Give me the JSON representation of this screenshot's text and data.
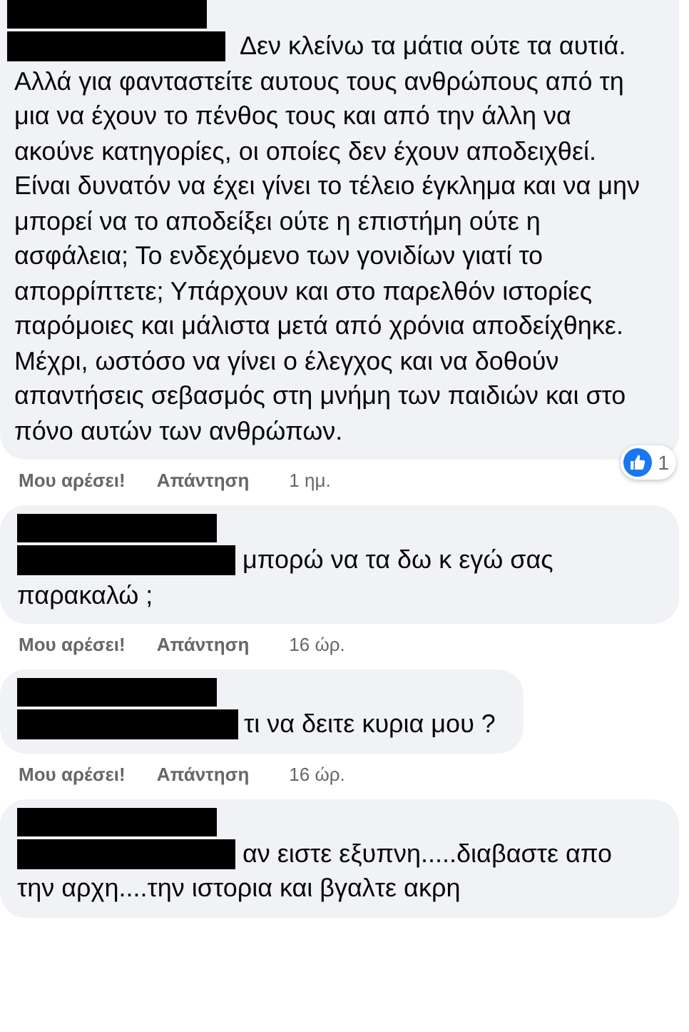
{
  "comments": [
    {
      "text": "Δεν κλείνω τα μάτια ούτε τα αυτιά. Αλλά για φανταστείτε αυτους τους ανθρώπους από τη μια να έχουν το πένθος τους και από την άλλη να ακούνε κατηγορίες, οι οποίες δεν έχουν αποδειχθεί. Είναι δυνατόν να έχει γίνει το τέλειο έγκλημα και να μην μπορεί να το αποδείξει ούτε η επιστήμη ούτε η ασφάλεια; Το ενδεχόμενο των γονιδίων γιατί το απορρίπτετε; Υπάρχουν και στο παρελθόν ιστορίες παρόμοιες και μάλιστα μετά από χρόνια αποδείχθηκε. Μέχρι, ωστόσο να γίνει ο έλεγχος και να δοθούν απαντήσεις σεβασμός στη μνήμη των παιδιών και στο πόνο αυτών των ανθρώπων.",
      "actions": {
        "like": "Μου αρέσει!",
        "reply": "Απάντηση",
        "time": "1 ημ."
      },
      "reactions": {
        "count": "1"
      }
    },
    {
      "text": "μπορώ να τα δω κ εγώ σας παρακαλώ ;",
      "actions": {
        "like": "Μου αρέσει!",
        "reply": "Απάντηση",
        "time": "16 ώρ."
      }
    },
    {
      "text": "τι να δειτε κυρια μου ?",
      "actions": {
        "like": "Μου αρέσει!",
        "reply": "Απάντηση",
        "time": "16 ώρ."
      }
    },
    {
      "text": "αν ειστε εξυπνη.....διαβαστε απο την αρχη....την ιστορια και βγαλτε ακρη"
    }
  ]
}
